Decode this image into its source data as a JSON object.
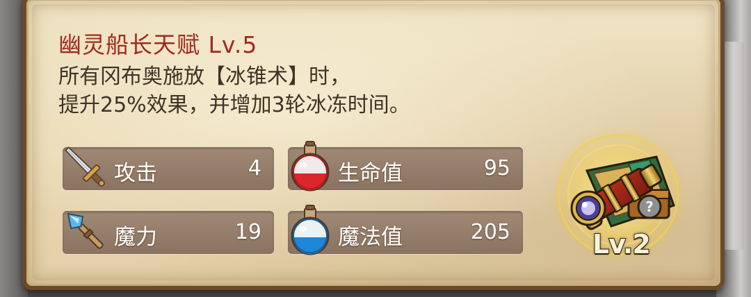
{
  "talent": {
    "title": "幽灵船长天赋 Lv.5",
    "description_lines": [
      "所有冈布奥施放【冰锥术】时，",
      "提升25%效果，并增加3轮冰冻时间。"
    ]
  },
  "stats": [
    {
      "label": "攻击",
      "value": "4",
      "icon": "sword-icon"
    },
    {
      "label": "生命值",
      "value": "95",
      "icon": "red-potion-icon"
    },
    {
      "label": "魔力",
      "value": "19",
      "icon": "magic-wand-icon"
    },
    {
      "label": "魔法值",
      "value": "205",
      "icon": "blue-potion-icon"
    }
  ],
  "item": {
    "icon": "spyglass-treasure-icon",
    "level": "Lv.2"
  },
  "colors": {
    "title": "#9e2b1f",
    "text": "#3f3326",
    "parchment": "#ecdfbe",
    "frame": "#6b4a2c",
    "stat_box": "#937b67"
  }
}
